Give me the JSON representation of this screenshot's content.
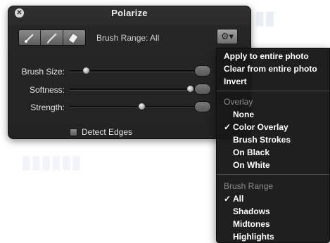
{
  "window": {
    "title": "Polarize",
    "brush_range_label": "Brush Range: All"
  },
  "controls": {
    "brush_size_label": "Brush Size:",
    "softness_label": "Softness:",
    "strength_label": "Strength:",
    "detect_edges_label": "Detect Edges",
    "detect_edges_checked": false,
    "brush_size_level": 0.13,
    "softness_level": 0.95,
    "strength_level": 0.57
  },
  "menu": {
    "apply_all": "Apply to entire photo",
    "clear_all": "Clear from entire photo",
    "invert": "Invert",
    "overlay_header": "Overlay",
    "overlay_items": [
      "None",
      "Color Overlay",
      "Brush Strokes",
      "On Black",
      "On White"
    ],
    "overlay_selected": "Color Overlay",
    "brush_range_header": "Brush Range",
    "brush_range_items": [
      "All",
      "Shadows",
      "Midtones",
      "Highlights"
    ],
    "brush_range_selected": "All",
    "checkmark": "✓"
  },
  "icons": {
    "close": "close-icon",
    "brush": "brush-icon",
    "feather_brush": "feather-brush-icon",
    "eraser": "eraser-icon",
    "gear": "gear-icon"
  },
  "colors": {
    "hud_background": "#262626",
    "menu_background": "#181818",
    "menu_header": "#8c8c8c"
  }
}
